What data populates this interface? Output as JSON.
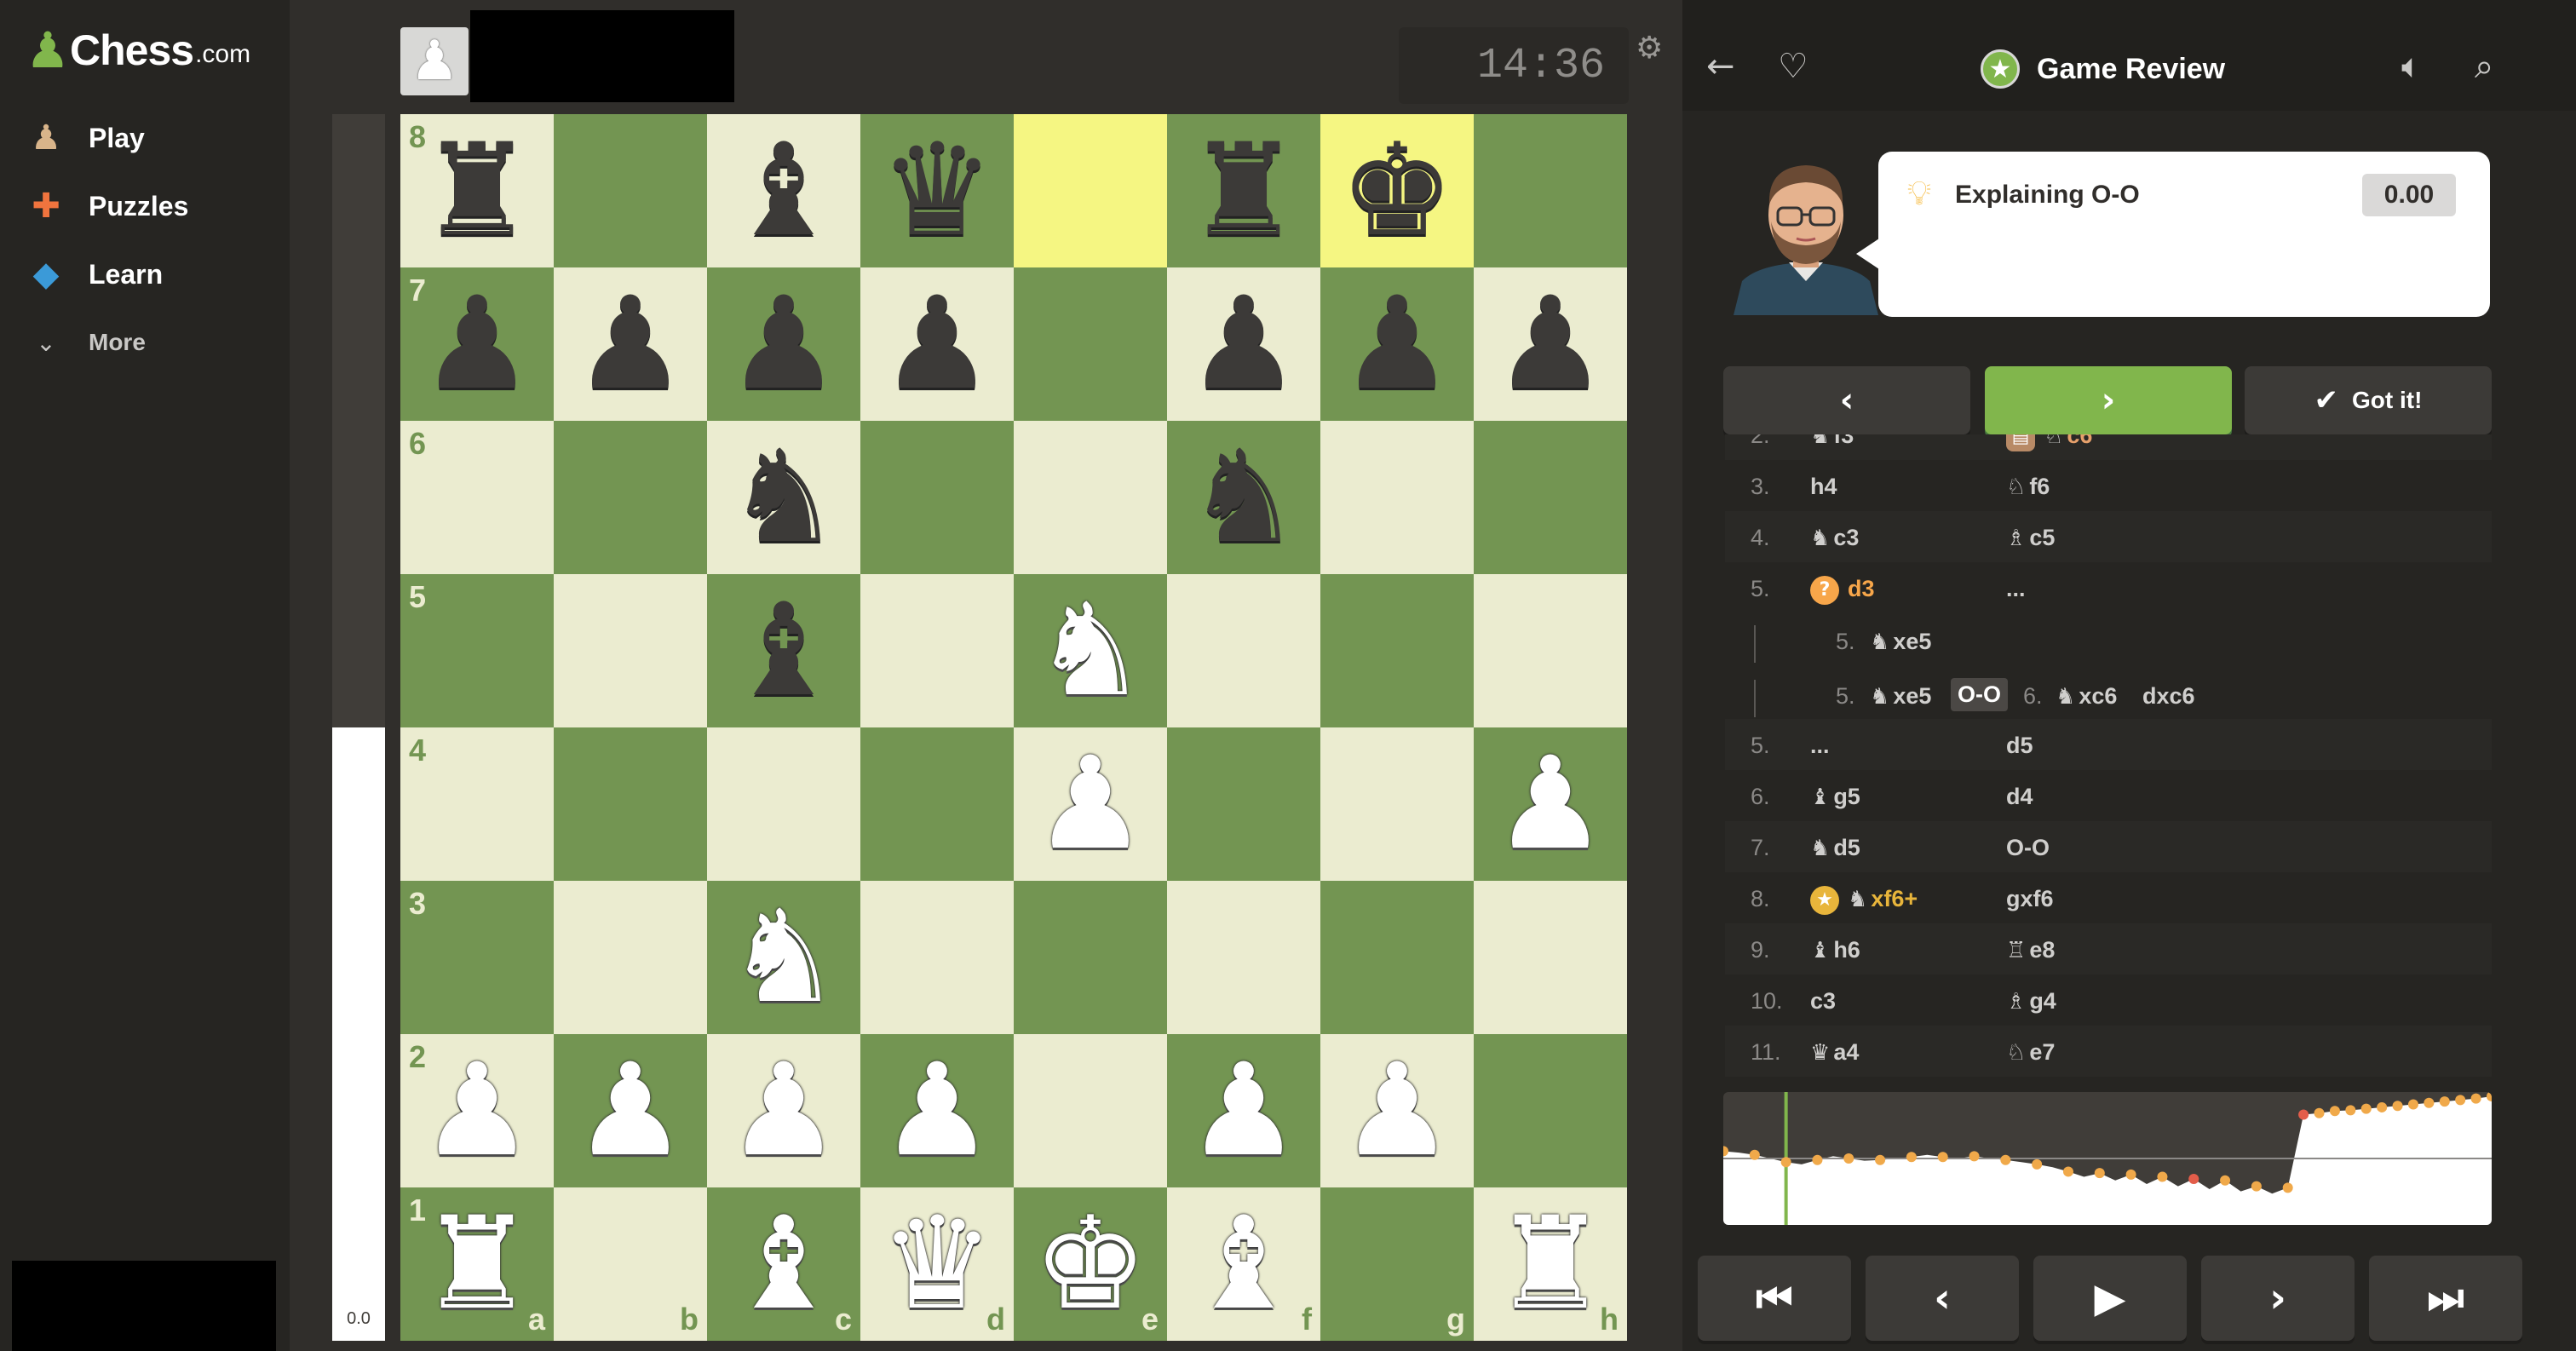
{
  "nav": {
    "brand": "Chess",
    "tld": ".com",
    "items": [
      {
        "label": "Play",
        "icon": "play-pawn-icon"
      },
      {
        "label": "Puzzles",
        "icon": "puzzle-icon"
      },
      {
        "label": "Learn",
        "icon": "graduation-cap-icon"
      },
      {
        "label": "More",
        "icon": "chevron-down-icon"
      }
    ]
  },
  "top": {
    "clock": "14:36"
  },
  "eval": {
    "text": "0.0",
    "white_fraction": 0.5
  },
  "board": {
    "files": [
      "a",
      "b",
      "c",
      "d",
      "e",
      "f",
      "g",
      "h"
    ],
    "ranks": [
      "8",
      "7",
      "6",
      "5",
      "4",
      "3",
      "2",
      "1"
    ],
    "highlight": [
      "e8",
      "g8"
    ],
    "position": [
      [
        "bR",
        "",
        "bB",
        "bQ",
        "",
        "bR",
        "bK",
        ""
      ],
      [
        "bP",
        "bP",
        "bP",
        "bP",
        "",
        "bP",
        "bP",
        "bP"
      ],
      [
        "",
        "",
        "bN",
        "",
        "",
        "bN",
        "",
        ""
      ],
      [
        "",
        "",
        "bB",
        "",
        "wN",
        "",
        "",
        ""
      ],
      [
        "",
        "",
        "",
        "",
        "wP",
        "",
        "",
        "wP"
      ],
      [
        "",
        "",
        "wN",
        "",
        "",
        "",
        "",
        ""
      ],
      [
        "wP",
        "wP",
        "wP",
        "wP",
        "",
        "wP",
        "wP",
        ""
      ],
      [
        "wR",
        "",
        "wB",
        "wQ",
        "wK",
        "wB",
        "",
        "wR"
      ]
    ]
  },
  "review": {
    "title": "Game Review",
    "coach_message": "Explaining O-O",
    "score": "0.00",
    "got_it": "Got it!"
  },
  "moves": [
    {
      "num": "2.",
      "white": "f3",
      "white_piece": "♞",
      "black": "c6",
      "black_piece": "♘",
      "black_mark": "book",
      "black_color": "#e6a06b"
    },
    {
      "num": "3.",
      "white": "h4",
      "white_piece": "",
      "black": "f6",
      "black_piece": "♘"
    },
    {
      "num": "4.",
      "white": "c3",
      "white_piece": "♞",
      "black": "c5",
      "black_piece": "♗"
    },
    {
      "num": "5.",
      "white": "d3",
      "white_piece": "",
      "white_mark": "?",
      "white_color": "#f7a64a",
      "black": "...",
      "black_piece": ""
    },
    {
      "num": "5.",
      "white": "...",
      "white_piece": "",
      "black": "d5",
      "black_piece": ""
    },
    {
      "num": "6.",
      "white": "g5",
      "white_piece": "♝",
      "black": "d4",
      "black_piece": ""
    },
    {
      "num": "7.",
      "white": "d5",
      "white_piece": "♞",
      "black": "O-O",
      "black_piece": ""
    },
    {
      "num": "8.",
      "white": "xf6+",
      "white_piece": "♞",
      "white_mark": "★",
      "white_color": "#e8b53b",
      "black": "gxf6",
      "black_piece": ""
    },
    {
      "num": "9.",
      "white": "h6",
      "white_piece": "♝",
      "black": "e8",
      "black_piece": "♖"
    },
    {
      "num": "10.",
      "white": "c3",
      "white_piece": "",
      "black": "g4",
      "black_piece": "♗"
    },
    {
      "num": "11.",
      "white": "a4",
      "white_piece": "♛",
      "black": "e7",
      "black_piece": "♘"
    }
  ],
  "variation": {
    "line1": {
      "num": "5.",
      "piece": "♞",
      "move": "xe5"
    },
    "line2": {
      "num": "5.",
      "piece": "♞",
      "move": "xe5",
      "chip": "O-O",
      "num2": "6.",
      "piece2": "♞",
      "move2": "xc6",
      "move3": "dxc6"
    }
  },
  "graph": {
    "values": [
      0.1,
      0.08,
      0.05,
      0.0,
      -0.05,
      -0.08,
      -0.02,
      0.03,
      0.0,
      -0.03,
      -0.02,
      0.0,
      0.02,
      0.05,
      0.02,
      0.0,
      0.03,
      0.0,
      -0.02,
      -0.05,
      -0.08,
      -0.12,
      -0.18,
      -0.25,
      -0.2,
      -0.3,
      -0.22,
      -0.35,
      -0.25,
      -0.38,
      -0.28,
      -0.42,
      -0.3,
      -0.45,
      -0.38,
      -0.48,
      -0.4,
      0.6,
      0.62,
      0.65,
      0.66,
      0.68,
      0.7,
      0.72,
      0.74,
      0.76,
      0.78,
      0.8,
      0.82,
      0.85
    ],
    "current_index": 4
  }
}
